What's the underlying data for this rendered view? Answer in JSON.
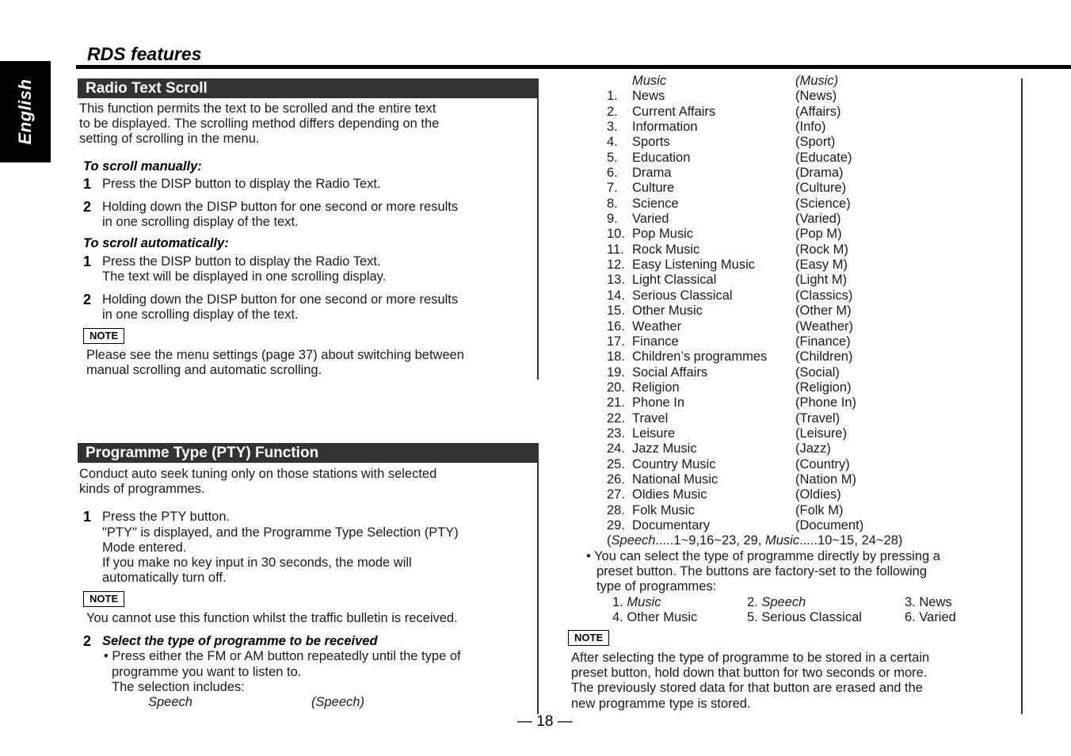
{
  "language_tab": "English",
  "page_title": "RDS features",
  "page_number": "— 18 —",
  "radio_text_scroll": {
    "header": "Radio Text Scroll",
    "intro": [
      "This function permits the text to be scrolled and the entire text",
      "to be displayed. The scrolling method differs depending on the",
      "setting of scrolling in the menu."
    ],
    "manual": {
      "heading": "To scroll manually:",
      "steps": [
        {
          "num": "1",
          "lines": [
            "Press the DISP button to display the Radio Text."
          ]
        },
        {
          "num": "2",
          "lines": [
            "Holding down the DISP button for one second or more results",
            "in one scrolling display of the text."
          ]
        }
      ]
    },
    "automatic": {
      "heading": "To scroll automatically:",
      "steps": [
        {
          "num": "1",
          "lines": [
            "Press the DISP button to display the Radio Text.",
            "The text will be displayed in one scrolling display."
          ]
        },
        {
          "num": "2",
          "lines": [
            "Holding down the DISP button for one second or more results",
            "in one scrolling display of the text."
          ]
        }
      ]
    },
    "note_label": "NOTE",
    "note_lines": [
      "Please see the menu settings (page 37) about switching between",
      "manual scrolling and automatic scrolling."
    ]
  },
  "pty_function": {
    "header": "Programme Type (PTY) Function",
    "intro": [
      "Conduct auto seek tuning only on those stations with selected",
      "kinds of programmes."
    ],
    "step1": {
      "num": "1",
      "lines": [
        "Press the PTY button.",
        "\"PTY\" is displayed, and the Programme Type Selection (PTY)",
        "Mode entered.",
        "If you make no key input in 30 seconds, the mode will",
        "automatically turn off."
      ]
    },
    "note1_label": "NOTE",
    "note1_text": "You cannot use this function whilst the traffic bulletin is received.",
    "step2": {
      "num": "2",
      "title": "Select the type of programme to be received",
      "bullet_lines": [
        "• Press either the FM or AM button repeatedly until the type of",
        "programme you want to listen to.",
        "The selection includes:"
      ],
      "first_item": {
        "name": "Speech",
        "abbr": "(Speech)"
      }
    },
    "programme_list": [
      {
        "num": "",
        "name": "Music",
        "abbr": "(Music)",
        "italic": true
      },
      {
        "num": "1.",
        "name": "News",
        "abbr": "(News)"
      },
      {
        "num": "2.",
        "name": "Current Affairs",
        "abbr": "(Affairs)"
      },
      {
        "num": "3.",
        "name": "Information",
        "abbr": "(Info)"
      },
      {
        "num": "4.",
        "name": "Sports",
        "abbr": "(Sport)"
      },
      {
        "num": "5.",
        "name": "Education",
        "abbr": "(Educate)"
      },
      {
        "num": "6.",
        "name": "Drama",
        "abbr": "(Drama)"
      },
      {
        "num": "7.",
        "name": "Culture",
        "abbr": "(Culture)"
      },
      {
        "num": "8.",
        "name": "Science",
        "abbr": "(Science)"
      },
      {
        "num": "9.",
        "name": "Varied",
        "abbr": "(Varied)"
      },
      {
        "num": "10.",
        "name": "Pop Music",
        "abbr": "(Pop M)"
      },
      {
        "num": "11.",
        "name": "Rock Music",
        "abbr": "(Rock M)"
      },
      {
        "num": "12.",
        "name": "Easy Listening Music",
        "abbr": "(Easy M)"
      },
      {
        "num": "13.",
        "name": "Light Classical",
        "abbr": "(Light M)"
      },
      {
        "num": "14.",
        "name": "Serious Classical",
        "abbr": "(Classics)"
      },
      {
        "num": "15.",
        "name": "Other Music",
        "abbr": "(Other M)"
      },
      {
        "num": "16.",
        "name": "Weather",
        "abbr": "(Weather)"
      },
      {
        "num": "17.",
        "name": "Finance",
        "abbr": "(Finance)"
      },
      {
        "num": "18.",
        "name": "Children’s programmes",
        "abbr": "(Children)"
      },
      {
        "num": "19.",
        "name": "Social Affairs",
        "abbr": "(Social)"
      },
      {
        "num": "20.",
        "name": "Religion",
        "abbr": "(Religion)"
      },
      {
        "num": "21.",
        "name": "Phone In",
        "abbr": "(Phone In)"
      },
      {
        "num": "22.",
        "name": "Travel",
        "abbr": "(Travel)"
      },
      {
        "num": "23.",
        "name": "Leisure",
        "abbr": "(Leisure)"
      },
      {
        "num": "24.",
        "name": "Jazz Music",
        "abbr": "(Jazz)"
      },
      {
        "num": "25.",
        "name": "Country Music",
        "abbr": "(Country)"
      },
      {
        "num": "26.",
        "name": "National Music",
        "abbr": "(Nation M)"
      },
      {
        "num": "27.",
        "name": "Oldies Music",
        "abbr": "(Oldies)"
      },
      {
        "num": "28.",
        "name": "Folk Music",
        "abbr": "(Folk M)"
      },
      {
        "num": "29.",
        "name": "Documentary",
        "abbr": "(Document)"
      }
    ],
    "grouping": {
      "speech_label": "Speech",
      "speech_range": ".....1~9,16~23, 29, ",
      "music_label": "Music",
      "music_range": ".....10~15, 24~28)"
    },
    "preset_bullet_lines": [
      "• You can select the type of programme directly by pressing a",
      "preset button. The buttons are factory-set to the following",
      "type of programmes:"
    ],
    "presets": [
      {
        "num": "1.",
        "name": "Music",
        "italic": true
      },
      {
        "num": "2.",
        "name": "Speech",
        "italic": true
      },
      {
        "num": "3.",
        "name": "News"
      },
      {
        "num": "4.",
        "name": "Other Music"
      },
      {
        "num": "5.",
        "name": "Serious Classical"
      },
      {
        "num": "6.",
        "name": "Varied"
      }
    ],
    "note2_label": "NOTE",
    "note2_lines": [
      "After selecting the type of programme to be stored in a certain",
      "preset button, hold down that button for two seconds or more.",
      "The previously stored data for that button are erased and the",
      "new programme type is stored."
    ]
  }
}
